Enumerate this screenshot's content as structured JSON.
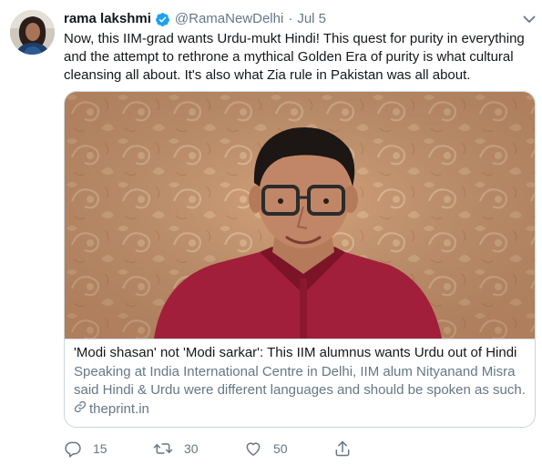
{
  "tweet": {
    "author_name": "rama lakshmi",
    "verified_icon": "verified-badge-icon",
    "handle": "@RamaNewDelhi",
    "separator": "·",
    "date": "Jul 5",
    "text": "Now, this IIM-grad wants Urdu-mukt Hindi! This quest for purity in everything and the attempt to rethrone a mythical Golden Era of purity is what cultural cleansing all about. It's also what Zia rule in Pakistan was all about."
  },
  "card": {
    "title": "'Modi shasan' not 'Modi sarkar': This IIM alumnus wants Urdu out of Hindi",
    "description": "Speaking at India International Centre in Delhi, IIM alum Nityanand Misra said Hindi & Urdu were different languages and should be spoken as such.",
    "link": "theprint.in"
  },
  "actions": {
    "reply_count": "15",
    "retweet_count": "30",
    "like_count": "50"
  },
  "colors": {
    "accent": "#1da1f2",
    "muted": "#657786",
    "border": "#ccd6dd",
    "wallpaper": "#d8a67c",
    "shirt": "#a11f3a"
  },
  "icons": {
    "caret": "chevron-down-icon",
    "reply": "reply-icon",
    "retweet": "retweet-icon",
    "like": "heart-icon",
    "share": "share-icon",
    "link": "link-icon"
  }
}
